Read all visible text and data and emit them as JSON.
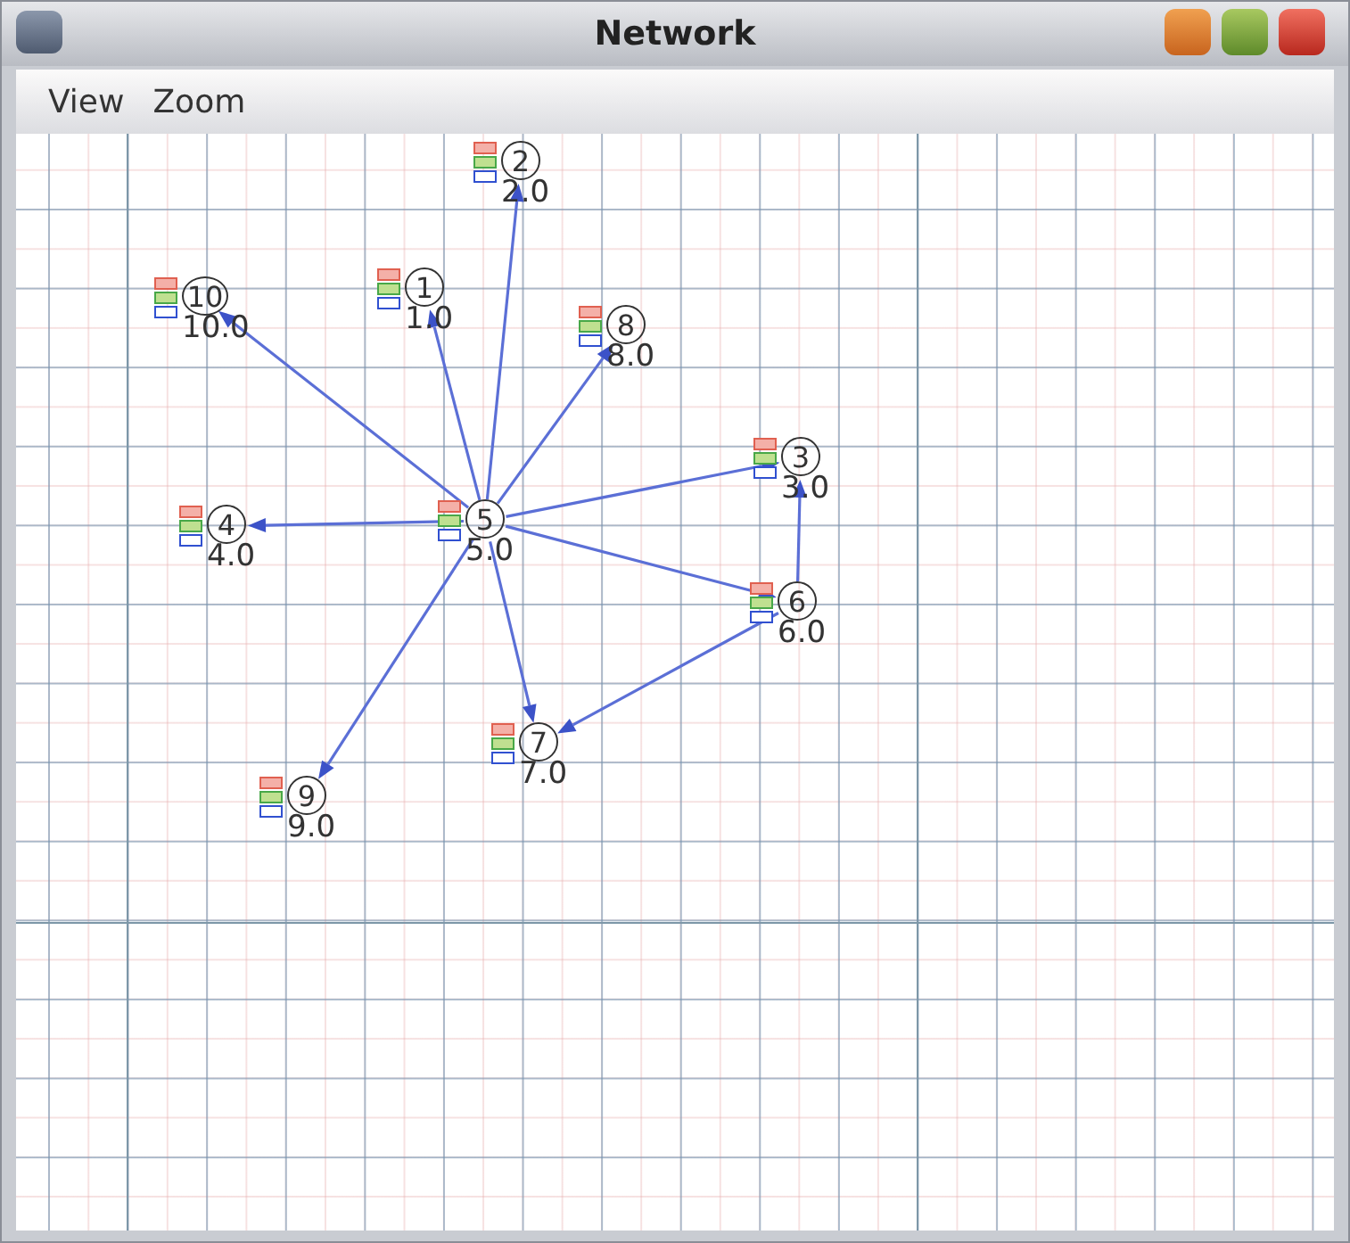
{
  "window": {
    "title": "Network"
  },
  "menu": [
    "View",
    "Zoom"
  ],
  "nodes": [
    {
      "label": "1",
      "value": "1.0"
    },
    {
      "label": "2",
      "value": "2.0"
    },
    {
      "label": "3",
      "value": "3.0"
    },
    {
      "label": "4",
      "value": "4.0"
    },
    {
      "label": "5",
      "value": "5.0"
    },
    {
      "label": "6",
      "value": "6.0"
    },
    {
      "label": "7",
      "value": "7.0"
    },
    {
      "label": "8",
      "value": "8.0"
    },
    {
      "label": "9",
      "value": "9.0"
    },
    {
      "label": "10",
      "value": "10.0"
    }
  ]
}
